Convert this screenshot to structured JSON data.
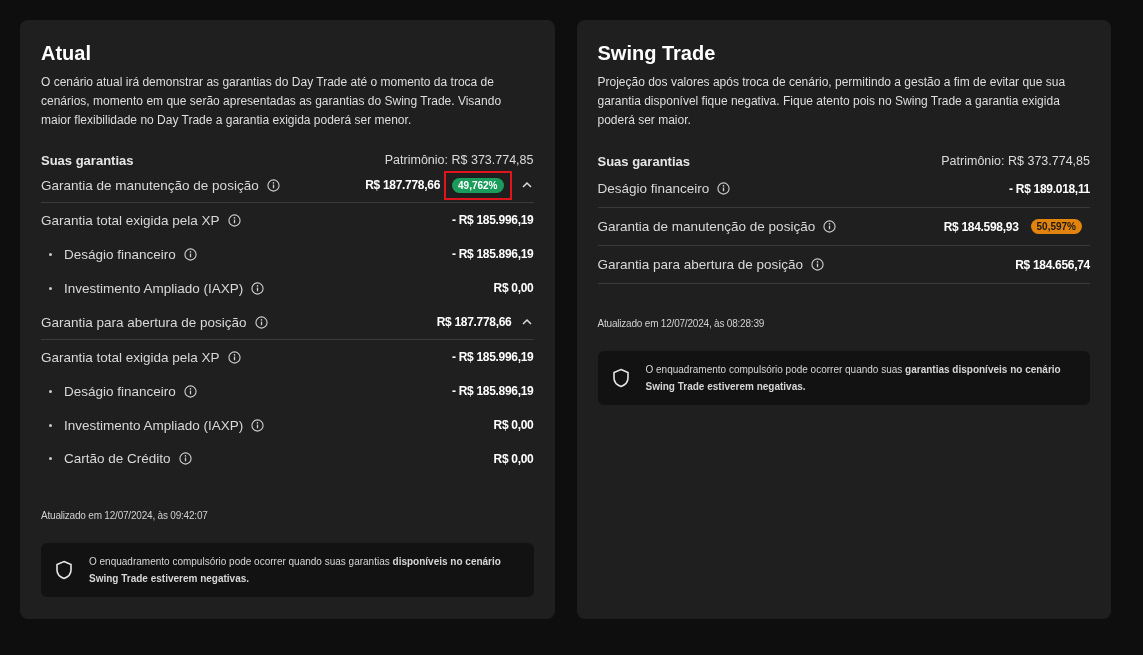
{
  "cards": [
    {
      "title": "Atual",
      "description": "O cenário atual irá demonstrar as garantias do Day Trade até o momento da troca de cenários, momento em que serão apresentadas as garantias do Swing Trade. Visando maior flexibilidade no Day Trade a garantia exigida poderá ser menor.",
      "section_label": "Suas garantias",
      "patrimonio": "Patrimônio: R$ 373.774,85",
      "rows": [
        {
          "kind": "section",
          "label": "Garantia de manutenção de posição",
          "value": "R$ 187.778,66",
          "badge": {
            "text": "49,762%",
            "color": "#1a9d5c",
            "highlighted": true
          },
          "expanded": true
        },
        {
          "kind": "sub",
          "label": "Garantia total exigida pela XP",
          "value": "- R$ 185.996,19"
        },
        {
          "kind": "bullet",
          "label": "Deságio financeiro",
          "value": "- R$ 185.896,19"
        },
        {
          "kind": "bullet",
          "label": "Investimento Ampliado (IAXP)",
          "value": "R$ 0,00"
        },
        {
          "kind": "section",
          "label": "Garantia para abertura de posição",
          "value": "R$ 187.778,66",
          "expanded": true
        },
        {
          "kind": "sub",
          "label": "Garantia total exigida pela XP",
          "value": "- R$ 185.996,19"
        },
        {
          "kind": "bullet",
          "label": "Deságio financeiro",
          "value": "- R$ 185.896,19"
        },
        {
          "kind": "bullet",
          "label": "Investimento Ampliado (IAXP)",
          "value": "R$ 0,00"
        },
        {
          "kind": "bullet",
          "label": "Cartão de Crédito",
          "value": "R$ 0,00"
        }
      ],
      "updated": "Atualizado em 12/07/2024, às 09:42:07",
      "notice": "O enquadramento compulsório pode ocorrer quando suas garantias **disponíveis no cenário Swing Trade estiverem negativas.**"
    },
    {
      "title": "Swing Trade",
      "description": "Projeção dos valores após troca de cenário, permitindo a gestão a fim de evitar que sua garantia disponível fique negativa. Fique atento pois no Swing Trade a garantia exigida poderá ser maior.",
      "section_label": "Suas garantias",
      "patrimonio": "Patrimônio: R$ 373.774,85",
      "rows": [
        {
          "kind": "line",
          "label": "Deságio financeiro",
          "value": "- R$ 189.018,11"
        },
        {
          "kind": "line",
          "label": "Garantia de manutenção de posição",
          "value": "R$ 184.598,93",
          "badge": {
            "text": "50,597%",
            "color": "#e2830d",
            "highlighted": false
          }
        },
        {
          "kind": "line",
          "label": "Garantia para abertura de posição",
          "value": "R$ 184.656,74"
        }
      ],
      "updated": "Atualizado em 12/07/2024, às 08:28:39",
      "notice": "O enquadramento compulsório pode ocorrer quando suas **garantias disponíveis no cenário Swing Trade estiverem negativas.**"
    }
  ]
}
